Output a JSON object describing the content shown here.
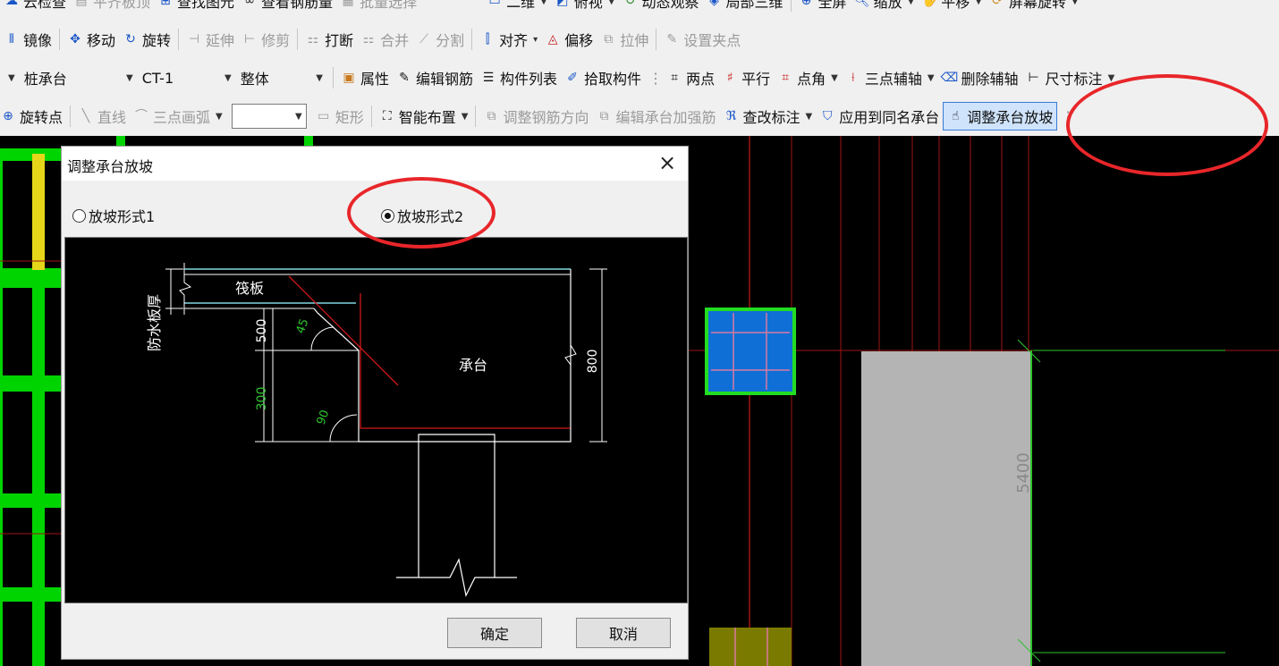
{
  "toolbar1": {
    "items": [
      "云检查",
      "平齐板顶",
      "查找图元",
      "查看钢筋量",
      "批量选择",
      "二维",
      "俯视",
      "动态观察",
      "局部三维",
      "全屏",
      "缩放",
      "平移",
      "屏幕旋转"
    ]
  },
  "toolbar2": {
    "mirror": "镜像",
    "move": "移动",
    "rotate": "旋转",
    "extend": "延伸",
    "trim": "修剪",
    "break": "打断",
    "merge": "合并",
    "split": "分割",
    "align": "对齐",
    "offset": "偏移",
    "stretch": "拉伸",
    "grip": "设置夹点"
  },
  "toolbar3": {
    "component_type": "桩承台",
    "component_name": "CT-1",
    "scope": "整体",
    "properties": "属性",
    "edit_rebar": "编辑钢筋",
    "component_list": "构件列表",
    "pick": "拾取构件",
    "two_points": "两点",
    "parallel": "平行",
    "point_angle": "点角",
    "three_point_axis": "三点辅轴",
    "delete_axis": "删除辅轴",
    "dimension": "尺寸标注"
  },
  "toolbar4": {
    "rotate_point": "旋转点",
    "line": "直线",
    "arc": "三点画弧",
    "rect": "矩形",
    "smart_layout": "智能布置",
    "adjust_rebar_dir": "调整钢筋方向",
    "edit_reinforce": "编辑承台加强筋",
    "modify_label": "查改标注",
    "apply_same_name": "应用到同名承台",
    "adjust_slope": "调整承台放坡"
  },
  "dialog": {
    "title": "调整承台放坡",
    "option1": "放坡形式1",
    "option2": "放坡形式2",
    "selected": 2,
    "ok": "确定",
    "cancel": "取消",
    "figure": {
      "raft": "筏板",
      "waterproof": "防水板厚",
      "cap": "承台",
      "dim_500": "500",
      "dim_300": "300",
      "dim_800": "800",
      "angle_45": "45",
      "angle_90": "90"
    }
  },
  "canvas": {
    "dimension": "5400"
  },
  "colors": {
    "highlight_circle": "#e8262a",
    "toolbar_bg": "#f0f0f0",
    "cad_green": "#00d400",
    "cad_yellow": "#e6d619",
    "axis_red": "#a01414",
    "cap_blue": "#0f6fd6",
    "cap_gray": "#b4b4b4"
  }
}
